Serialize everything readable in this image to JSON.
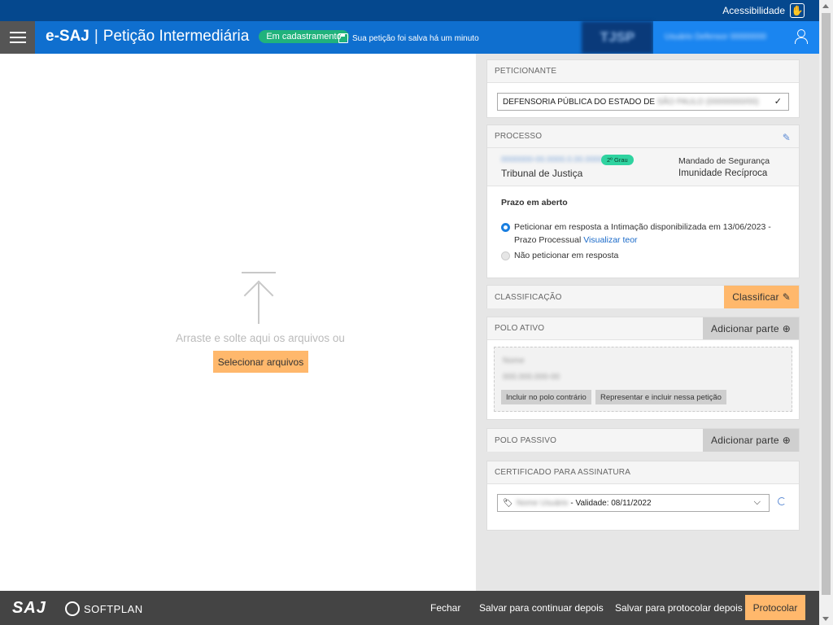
{
  "topbar": {
    "accessibility_label": "Acessibilidade"
  },
  "header": {
    "brand": "e-SAJ",
    "separator": "|",
    "title": "Petição Intermediária",
    "status": "Em cadastramento",
    "saved_text": "Sua petição foi salva há um minuto",
    "court_logo": "TJSP",
    "user_name": "Usuário Defensor 00000000"
  },
  "upload": {
    "drop_text": "Arraste e solte aqui os arquivos ou",
    "select_button": "Selecionar arquivos"
  },
  "peticionante": {
    "heading": "PETICIONANTE",
    "value": "DEFENSORIA PÚBLICA DO ESTADO DE",
    "value_hidden": "SÃO PAULO (00000000/00)"
  },
  "processo": {
    "heading": "PROCESSO",
    "number": "0000000-00.0000.0.00.0000",
    "grau": "2º Grau",
    "tribunal": "Tribunal de Justiça",
    "classe": "Mandado de Segurança",
    "assunto": "Imunidade Recíproca",
    "prazo_title": "Prazo em aberto",
    "option1_line1": "Peticionar em resposta a Intimação disponibilizada em 13/06/2023 -",
    "option1_line2": "Prazo Processual",
    "option1_link": "Visualizar teor",
    "option2": "Não peticionar em resposta"
  },
  "classificacao": {
    "heading": "CLASSIFICAÇÃO",
    "button": "Classificar"
  },
  "polo_ativo": {
    "heading": "POLO ATIVO",
    "button": "Adicionar parte",
    "party_name": "Nome",
    "party_doc": "000.000.000-00",
    "btn_contrario": "Incluir no polo contrário",
    "btn_representar": "Representar e incluir nessa petição"
  },
  "polo_passivo": {
    "heading": "POLO PASSIVO",
    "button": "Adicionar parte"
  },
  "certificado": {
    "heading": "CERTIFICADO PARA ASSINATURA",
    "name": "Nome Usuário",
    "validity": "- Validade: 08/11/2022"
  },
  "footer": {
    "saj": "SAJ",
    "softplan": "SOFTPLAN",
    "fechar": "Fechar",
    "salvar_continuar": "Salvar para continuar depois",
    "salvar_protocolar": "Salvar para protocolar depois",
    "protocolar": "Protocolar"
  }
}
